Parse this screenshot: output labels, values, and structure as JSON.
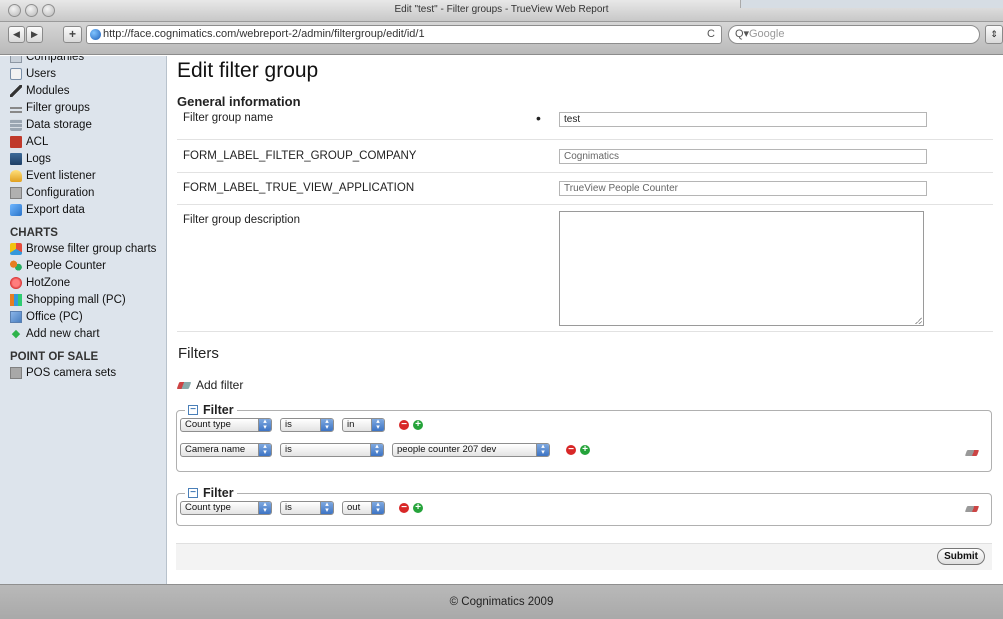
{
  "window": {
    "title": "Edit \"test\" - Filter groups - TrueView Web Report",
    "url": "http://face.cognimatics.com/webreport-2/admin/filtergroup/edit/id/1",
    "search_placeholder": "Google",
    "reload_glyph": "C"
  },
  "sidebar": {
    "items": [
      {
        "label": "Companies",
        "icon": "companies-icon"
      },
      {
        "label": "Users",
        "icon": "users-icon"
      },
      {
        "label": "Modules",
        "icon": "modules-icon"
      },
      {
        "label": "Filter groups",
        "icon": "filter-groups-icon"
      },
      {
        "label": "Data storage",
        "icon": "data-storage-icon"
      },
      {
        "label": "ACL",
        "icon": "acl-icon"
      },
      {
        "label": "Logs",
        "icon": "logs-icon"
      },
      {
        "label": "Event listener",
        "icon": "event-listener-icon"
      },
      {
        "label": "Configuration",
        "icon": "configuration-icon"
      },
      {
        "label": "Export data",
        "icon": "export-data-icon"
      }
    ],
    "charts_heading": "CHARTS",
    "charts": [
      {
        "label": "Browse filter group charts",
        "icon": "browse-charts-icon"
      },
      {
        "label": "People Counter",
        "icon": "people-counter-icon"
      },
      {
        "label": "HotZone",
        "icon": "hotzone-icon"
      },
      {
        "label": "Shopping mall (PC)",
        "icon": "shopping-mall-icon"
      },
      {
        "label": "Office (PC)",
        "icon": "office-icon"
      },
      {
        "label": "Add new chart",
        "icon": "add-chart-icon"
      }
    ],
    "pos_heading": "POINT OF SALE",
    "pos": [
      {
        "label": "POS camera sets",
        "icon": "pos-camera-icon"
      }
    ]
  },
  "main": {
    "title": "Edit filter group",
    "general_heading": "General information",
    "fields": {
      "name_label": "Filter group name",
      "name_value": "test",
      "required_mark": "•",
      "company_label": "FORM_LABEL_FILTER_GROUP_COMPANY",
      "company_value": "Cognimatics",
      "app_label": "FORM_LABEL_TRUE_VIEW_APPLICATION",
      "app_value": "TrueView People Counter",
      "desc_label": "Filter group description",
      "desc_value": ""
    },
    "filters_heading": "Filters",
    "add_filter_label": "Add filter",
    "filter_legend": "Filter",
    "filter1": {
      "row1": {
        "field": "Count type",
        "op": "is",
        "value": "in"
      },
      "row2": {
        "field": "Camera name",
        "op": "is",
        "value": "people counter 207 dev"
      }
    },
    "filter2": {
      "row1": {
        "field": "Count type",
        "op": "is",
        "value": "out"
      }
    },
    "submit_label": "Submit"
  },
  "footer": {
    "text": "© Cognimatics 2009"
  }
}
